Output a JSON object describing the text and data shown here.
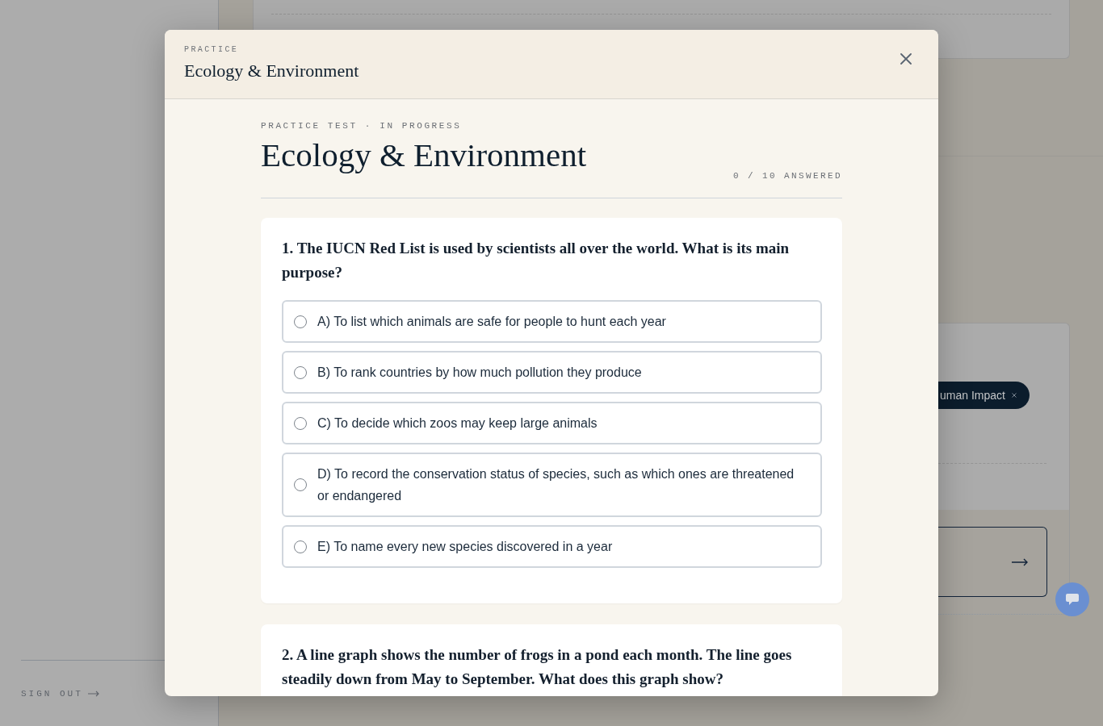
{
  "background": {
    "chip": {
      "label": "uman Impact"
    },
    "sign_out": {
      "label": "SIGN OUT"
    }
  },
  "modal": {
    "eyebrow": "PRACTICE",
    "title": "Ecology & Environment"
  },
  "test": {
    "status": "PRACTICE TEST · IN PROGRESS",
    "title": "Ecology & Environment",
    "progress": "0 / 10 ANSWERED"
  },
  "questions": [
    {
      "prompt": "1. The IUCN Red List is used by scientists all over the world. What is its main purpose?",
      "options": [
        {
          "label": "A) To list which animals are safe for people to hunt each year",
          "selected": false
        },
        {
          "label": "B) To rank countries by how much pollution they produce",
          "selected": false
        },
        {
          "label": "C) To decide which zoos may keep large animals",
          "selected": false
        },
        {
          "label": "D) To record the conservation status of species, such as which ones are threatened or endangered",
          "selected": false
        },
        {
          "label": "E) To name every new species discovered in a year",
          "selected": false
        }
      ]
    },
    {
      "prompt": "2. A line graph shows the number of frogs in a pond each month. The line goes steadily down from May to September. What does this graph show?"
    }
  ]
}
